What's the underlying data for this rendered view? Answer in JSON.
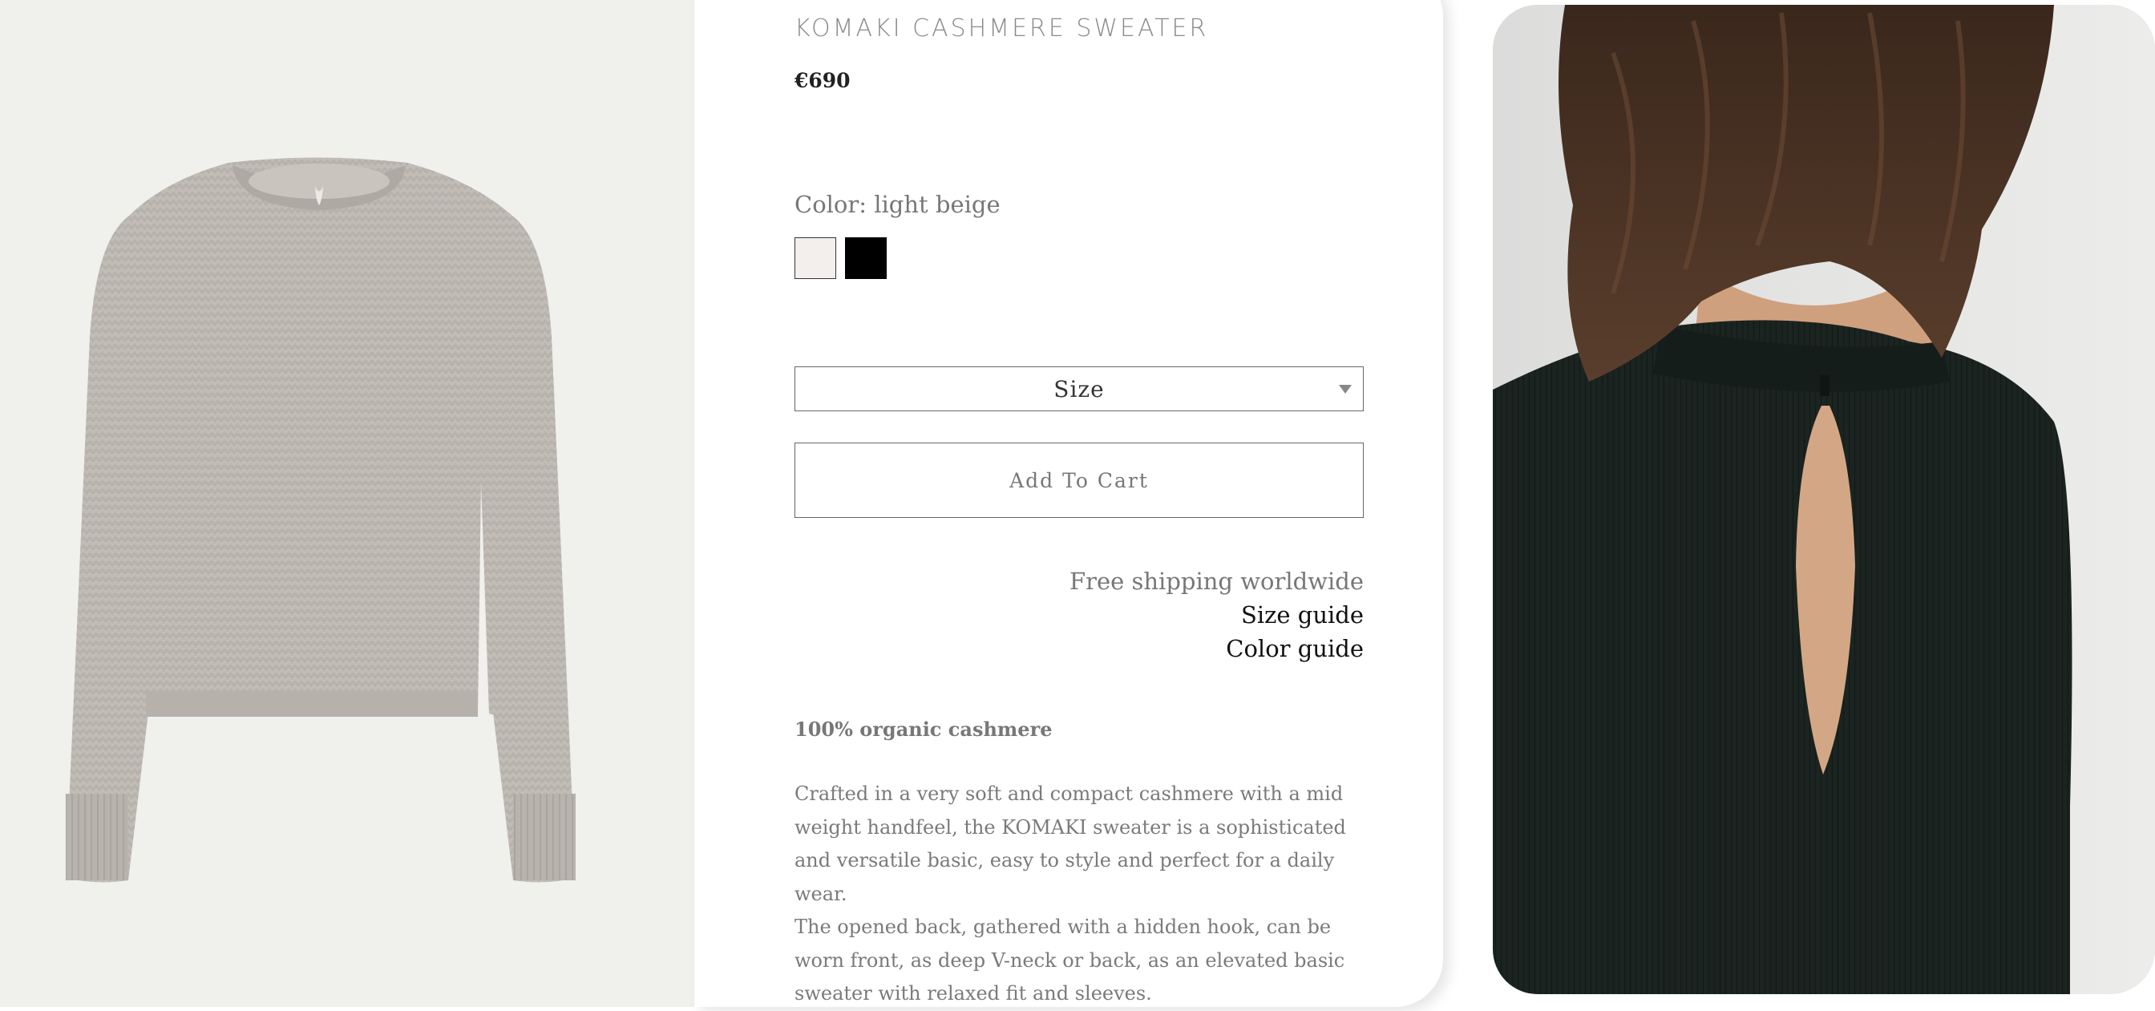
{
  "product": {
    "title": "KOMAKI CASHMERE SWEATER",
    "price": "€690"
  },
  "color": {
    "label": "Color: light beige",
    "swatches": [
      {
        "name": "light beige",
        "hex": "#f2efec",
        "selected": true
      },
      {
        "name": "black",
        "hex": "#000000",
        "selected": false
      }
    ]
  },
  "size_select": {
    "label": "Size",
    "icon": "chevron-down-icon"
  },
  "cart": {
    "button_label": "Add To Cart"
  },
  "links": {
    "shipping": "Free shipping worldwide",
    "size_guide": "Size guide",
    "color_guide": "Color guide"
  },
  "description": {
    "heading": "100% organic cashmere",
    "paragraph_1": "Crafted in a very soft and compact cashmere with a mid weight handfeel, the KOMAKI sweater is a sophisticated and versatile basic, easy to style and perfect for a daily wear.",
    "paragraph_2": "The opened back, gathered with a hidden hook, can be worn front, as deep V-neck or back, as an elevated basic sweater with relaxed fit and sleeves."
  },
  "colors": {
    "left_bg": "#f0f0ed",
    "sweater_beige": "#bdb8b2",
    "sweater_black": "#1b2421",
    "hair": "#4a3426",
    "skin": "#d9ad8c"
  }
}
